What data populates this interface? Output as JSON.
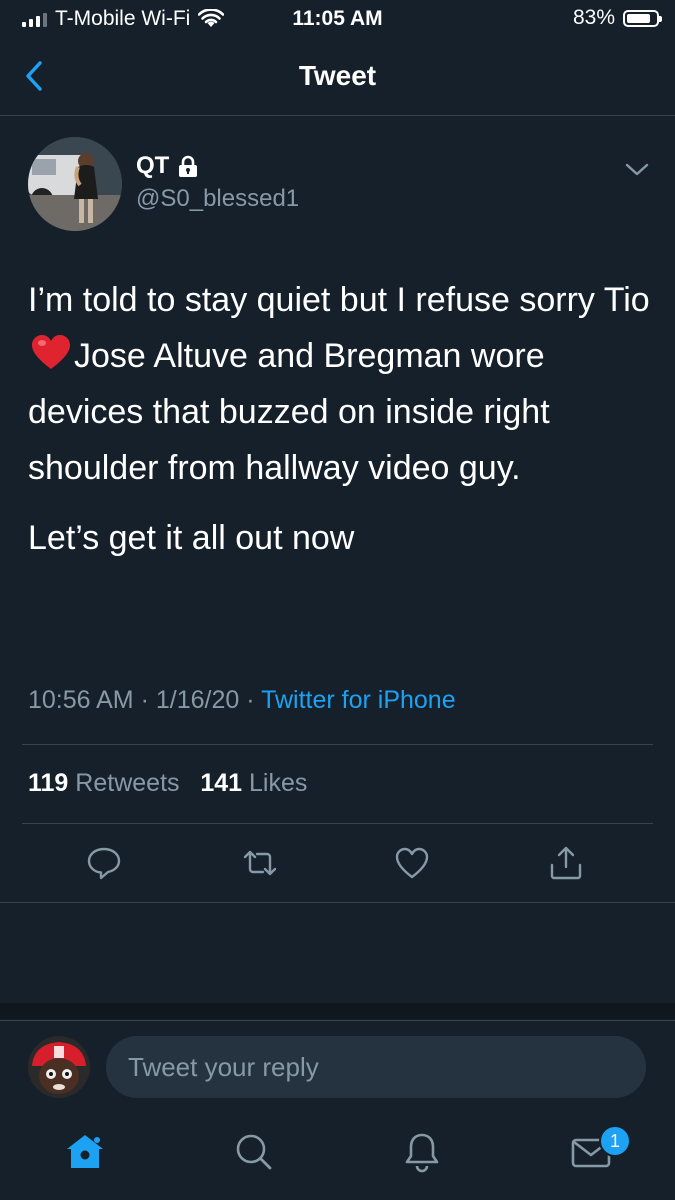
{
  "status_bar": {
    "carrier": "T-Mobile Wi-Fi",
    "time": "11:05 AM",
    "battery_percent": "83%",
    "battery_level": 0.83
  },
  "nav": {
    "title": "Tweet",
    "back_icon": "chevron-left-icon"
  },
  "tweet": {
    "author_name": "QT",
    "author_handle": "@S0_blessed1",
    "protected_icon": "lock-icon",
    "text_line1_before": "I’m told to stay quiet but I refuse sorry Tio",
    "text_line1_after": "Jose Altuve and Bregman wore devices that buzzed on inside right shoulder from hallway video guy.",
    "text_line2": "Let’s get it all out now",
    "time": "10:56 AM",
    "date": "1/16/20",
    "source": "Twitter for iPhone",
    "sep": "·"
  },
  "stats": {
    "retweets_count": "119",
    "retweets_label": "Retweets",
    "likes_count": "141",
    "likes_label": "Likes"
  },
  "actions": [
    "reply-icon",
    "retweet-icon",
    "like-icon",
    "share-icon"
  ],
  "reply": {
    "placeholder": "Tweet your reply"
  },
  "tabbar": {
    "items": [
      "home-icon",
      "search-icon",
      "notifications-icon",
      "messages-icon"
    ],
    "messages_badge": "1"
  },
  "colors": {
    "background": "#15202b",
    "accent": "#1da1f2",
    "secondary_text": "#8899a6",
    "divider": "#38444d"
  }
}
